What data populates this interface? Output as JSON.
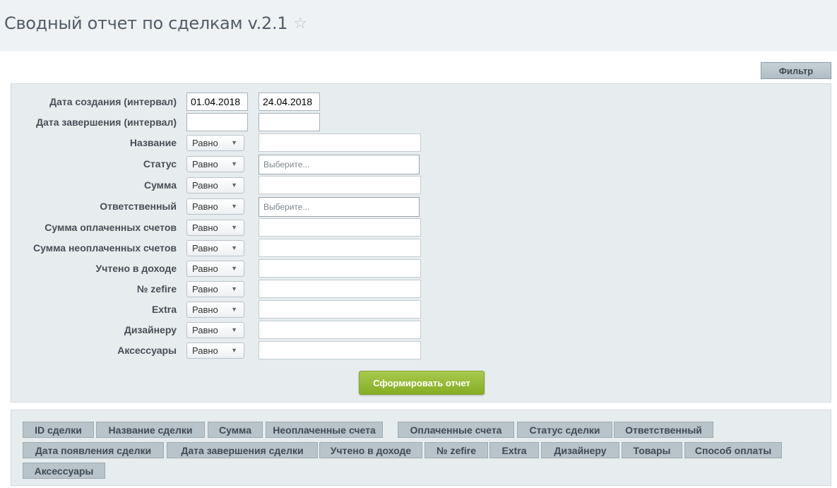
{
  "page": {
    "title": "Сводный отчет по сделкам v.2.1",
    "star_icon": "☆"
  },
  "toolbar": {
    "filter_label": "Фильтр"
  },
  "filters": {
    "created": {
      "label": "Дата создания (интервал)",
      "from": "01.04.2018",
      "to": "24.04.2018"
    },
    "completed": {
      "label": "Дата завершения (интервал)",
      "from": "",
      "to": ""
    },
    "conditions": [
      {
        "label": "Название",
        "operator": "Равно",
        "value": "",
        "placeholder": ""
      },
      {
        "label": "Статус",
        "operator": "Равно",
        "value": "",
        "placeholder": "Выберите..."
      },
      {
        "label": "Сумма",
        "operator": "Равно",
        "value": "",
        "placeholder": ""
      },
      {
        "label": "Ответственный",
        "operator": "Равно",
        "value": "",
        "placeholder": "Выберите..."
      },
      {
        "label": "Сумма оплаченных счетов",
        "operator": "Равно",
        "value": "",
        "placeholder": ""
      },
      {
        "label": "Сумма неоплаченных счетов",
        "operator": "Равно",
        "value": "",
        "placeholder": ""
      },
      {
        "label": "Учтено в доходе",
        "operator": "Равно",
        "value": "",
        "placeholder": ""
      },
      {
        "label": "№ zefire",
        "operator": "Равно",
        "value": "",
        "placeholder": ""
      },
      {
        "label": "Extra",
        "operator": "Равно",
        "value": "",
        "placeholder": ""
      },
      {
        "label": "Дизайнеру",
        "operator": "Равно",
        "value": "",
        "placeholder": ""
      },
      {
        "label": "Аксессуары",
        "operator": "Равно",
        "value": "",
        "placeholder": ""
      }
    ],
    "dropdown_icon": "▼",
    "submit_label": "Сформировать отчет"
  },
  "columns": [
    "ID сделки",
    "Название сделки",
    "Сумма",
    "Неоплаченные счета",
    "Оплаченные счета",
    "Статус сделки",
    "Ответственный",
    "Дата появления сделки",
    "Дата завершения сделки",
    "Учтено в доходе",
    "№ zefire",
    "Extra",
    "Дизайнеру",
    "Товары",
    "Способ оплаты",
    "Аксессуары"
  ],
  "colors": {
    "header_bg": "#eef2f4",
    "panel_bg": "#e7ecee",
    "submit_green": "#96bb35",
    "tag_bg": "#b8c3ca"
  }
}
